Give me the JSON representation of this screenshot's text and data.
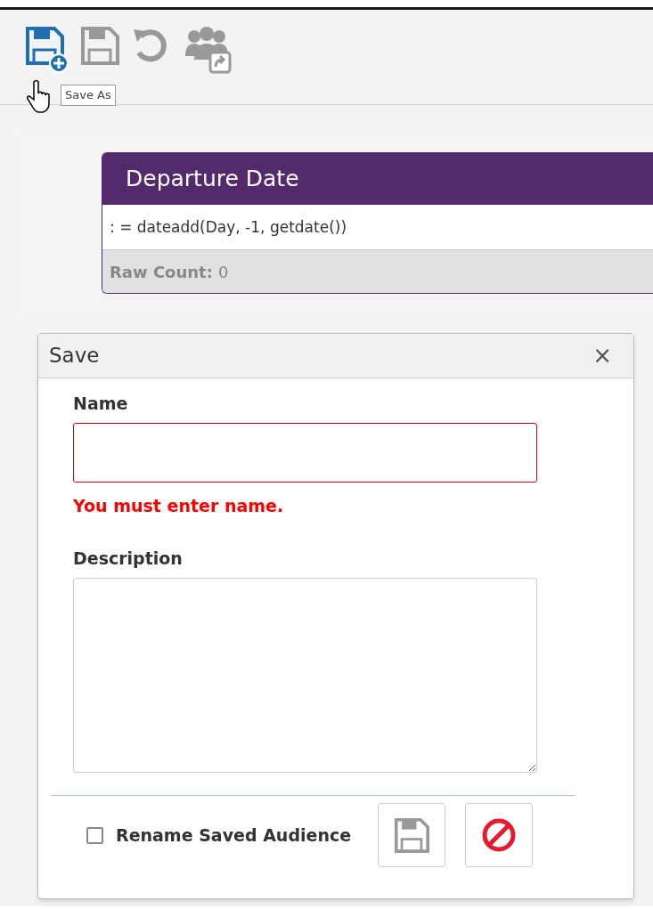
{
  "toolbar": [
    {
      "kind": "save_as",
      "disabled": false
    },
    {
      "kind": "save",
      "disabled": true
    },
    {
      "kind": "undo",
      "disabled": true
    },
    {
      "kind": "share_group",
      "disabled": true
    }
  ],
  "tooltip": "Save As",
  "card": {
    "title": "Departure Date",
    "formula": ": = dateadd(Day, -1, getdate())",
    "count_label": "Raw Count:",
    "count": "0"
  },
  "dialog": {
    "title": "Save",
    "close": "×",
    "name": {
      "label": "Name",
      "invalid": true,
      "error": "You must enter name."
    },
    "description": {
      "label": "Description"
    },
    "rename": {
      "label": "Rename Saved Audience",
      "checked": false
    },
    "buttons": [
      {
        "kind": "save",
        "disabled": true
      },
      {
        "kind": "cancel",
        "disabled": false
      }
    ]
  }
}
